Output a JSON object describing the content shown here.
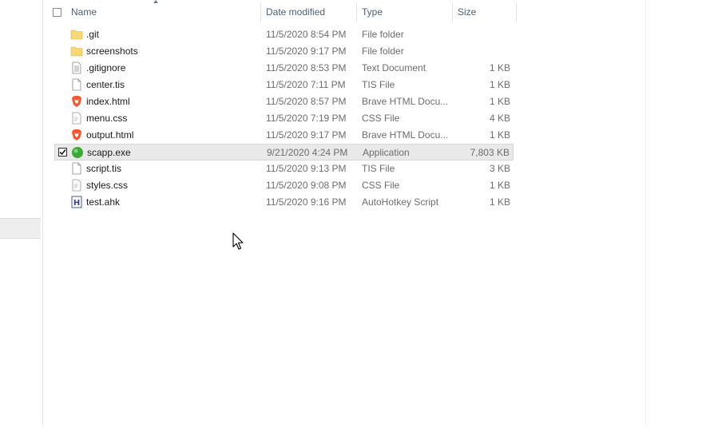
{
  "columns": {
    "name": "Name",
    "date": "Date modified",
    "type": "Type",
    "size": "Size"
  },
  "files": [
    {
      "name": ".git",
      "date": "11/5/2020 8:54 PM",
      "type": "File folder",
      "size": "",
      "icon": "folder-icon"
    },
    {
      "name": "screenshots",
      "date": "11/5/2020 9:17 PM",
      "type": "File folder",
      "size": "",
      "icon": "folder-icon"
    },
    {
      "name": ".gitignore",
      "date": "11/5/2020 8:53 PM",
      "type": "Text Document",
      "size": "1 KB",
      "icon": "text-file-icon"
    },
    {
      "name": "center.tis",
      "date": "11/5/2020 7:11 PM",
      "type": "TIS File",
      "size": "1 KB",
      "icon": "blank-file-icon"
    },
    {
      "name": "index.html",
      "date": "11/5/2020 8:57 PM",
      "type": "Brave HTML Docu...",
      "size": "1 KB",
      "icon": "brave-icon"
    },
    {
      "name": "menu.css",
      "date": "11/5/2020 7:19 PM",
      "type": "CSS File",
      "size": "4 KB",
      "icon": "css-file-icon"
    },
    {
      "name": "output.html",
      "date": "11/5/2020 9:17 PM",
      "type": "Brave HTML Docu...",
      "size": "1 KB",
      "icon": "brave-icon"
    },
    {
      "name": "scapp.exe",
      "date": "9/21/2020 4:24 PM",
      "type": "Application",
      "size": "7,803 KB",
      "icon": "app-icon",
      "selected": true
    },
    {
      "name": "script.tis",
      "date": "11/5/2020 9:13 PM",
      "type": "TIS File",
      "size": "3 KB",
      "icon": "blank-file-icon"
    },
    {
      "name": "styles.css",
      "date": "11/5/2020 9:08 PM",
      "type": "CSS File",
      "size": "1 KB",
      "icon": "css-file-icon"
    },
    {
      "name": "test.ahk",
      "date": "11/5/2020 9:16 PM",
      "type": "AutoHotkey Script",
      "size": "1 KB",
      "icon": "ahk-icon"
    }
  ],
  "colors": {
    "header_text": "#4c607a",
    "folder": "#f8d775",
    "brave": "#fb542b",
    "app": "#3aaa35",
    "ahk": "#334499"
  }
}
